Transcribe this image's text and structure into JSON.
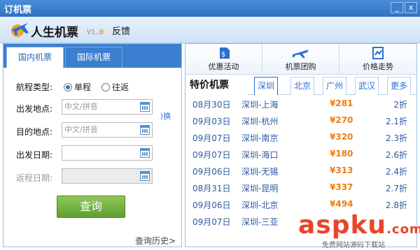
{
  "window": {
    "title": "订机票",
    "minimize": "_",
    "close": "x"
  },
  "brand": {
    "name": "人生机票",
    "version": "V1.0",
    "feedback": "反馈"
  },
  "left_tabs": [
    {
      "label": "国内机票"
    },
    {
      "label": "国际机票"
    }
  ],
  "form": {
    "trip_type_label": "航程类型:",
    "trip_options": [
      {
        "label": "单程",
        "selected": true
      },
      {
        "label": "往返",
        "selected": false
      }
    ],
    "from_label": "出发地点:",
    "from_placeholder": "中文/拼音",
    "to_label": "目的地点:",
    "to_placeholder": "中文/拼音",
    "swap_label": "换",
    "depart_label": "出发日期:",
    "return_label": "返程日期:",
    "search_button": "查询",
    "history_link": "查询历史>"
  },
  "tools": [
    {
      "label": "优惠活动",
      "icon": "coupon-icon"
    },
    {
      "label": "机票团购",
      "icon": "airplane-icon"
    },
    {
      "label": "价格走势",
      "icon": "chart-icon"
    }
  ],
  "special": {
    "title": "特价机票",
    "city_tabs": [
      "深圳",
      "北京",
      "广州",
      "武汉",
      "更多"
    ],
    "active_city": "深圳",
    "flights": [
      {
        "date": "08月30日",
        "route": "深圳-上海",
        "price": "¥281",
        "discount": "2折"
      },
      {
        "date": "09月03日",
        "route": "深圳-杭州",
        "price": "¥270",
        "discount": "2.1折"
      },
      {
        "date": "09月07日",
        "route": "深圳-南京",
        "price": "¥320",
        "discount": "2.3折"
      },
      {
        "date": "09月07日",
        "route": "深圳-海口",
        "price": "¥180",
        "discount": "2.6折"
      },
      {
        "date": "09月06日",
        "route": "深圳-无锡",
        "price": "¥313",
        "discount": "2.4折"
      },
      {
        "date": "08月31日",
        "route": "深圳-昆明",
        "price": "¥337",
        "discount": "2.7折"
      },
      {
        "date": "09月06日",
        "route": "深圳-北京",
        "price": "¥494",
        "discount": "2.8折"
      },
      {
        "date": "09月07日",
        "route": "深圳-三亚",
        "price": "",
        "discount": ""
      }
    ]
  },
  "watermark": {
    "text": "aspku",
    "suffix": ".com",
    "sub": "免费网站源码下载站"
  },
  "colors": {
    "accent": "#2b6fd1",
    "price": "#f07c12",
    "search_green": "#6aab3a"
  }
}
